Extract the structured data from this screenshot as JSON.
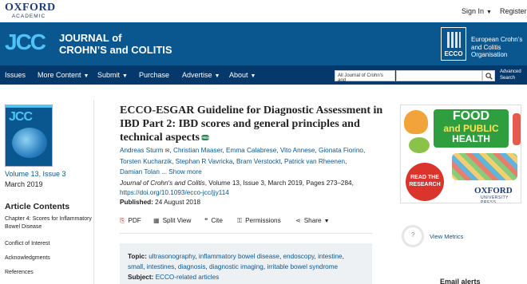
{
  "topbar": {
    "logo_line1": "OXFORD",
    "logo_line2": "ACADEMIC",
    "signin": "Sign In",
    "register": "Register"
  },
  "journal": {
    "logo": "JCC",
    "title_line1": "JOURNAL of",
    "title_line2": "CROHN’S and COLITIS",
    "ecco_badge": "ECCO",
    "ecco_org": "European Crohn’s and Colitis Organisation"
  },
  "nav": {
    "items": [
      "Issues",
      "More Content",
      "Submit",
      "Purchase",
      "Advertise",
      "About"
    ],
    "search_scope": "All Journal of Crohn's and",
    "search_value": "",
    "advanced_search": "Advanced Search"
  },
  "sidebar": {
    "volume": "Volume 13, Issue 3",
    "date": "March 2019",
    "contents_title": "Article Contents",
    "toc": [
      "Chapter 4: Scores for Inflammatory Bowel Disease",
      "Conflict of Interest",
      "Acknowledgments",
      "References"
    ]
  },
  "article": {
    "title": "ECCO-ESGAR Guideline for Diagnostic Assessment in IBD Part 2: IBD scores and general principles and technical aspects",
    "free_badge": "FREE",
    "authors": [
      "Andreas Sturm",
      "Christian Maaser",
      "Emma Calabrese",
      "Vito Annese",
      "Gionata Fiorino",
      "Torsten Kucharzik",
      "Stephan R Vavricka",
      "Bram Verstockt",
      "Patrick van Rheenen",
      "Damian Tolan"
    ],
    "show_more": "... Show more",
    "journal_name": "Journal of Crohn's and Colitis",
    "citation_rest": ", Volume 13, Issue 3, March 2019, Pages 273–284,",
    "doi": "https://doi.org/10.1093/ecco-jcc/jjy114",
    "published_label": "Published:",
    "published_date": "24 August 2018"
  },
  "toolbar": {
    "pdf": "PDF",
    "split_view": "Split View",
    "cite": "Cite",
    "permissions": "Permissions",
    "share": "Share"
  },
  "topics": {
    "topic_label": "Topic:",
    "topic_list": [
      "ultrasonography",
      "inflammatory bowel disease",
      "endoscopy",
      "intestine",
      "small",
      "intestines",
      "diagnosis",
      "diagnostic imaging",
      "irritable bowel syndrome"
    ],
    "subject_label": "Subject:",
    "subject": "ECCO-related articles"
  },
  "ad": {
    "line1": "FOOD",
    "line2": "and PUBLIC",
    "line3": "HEALTH",
    "cta_line1": "READ THE",
    "cta_line2": "RESEARCH",
    "publisher1": "OXFORD",
    "publisher2": "UNIVERSITY PRESS"
  },
  "metrics": {
    "view_metrics": "View Metrics",
    "altmetric_value": "?"
  },
  "alerts": {
    "title": "Email alerts"
  }
}
